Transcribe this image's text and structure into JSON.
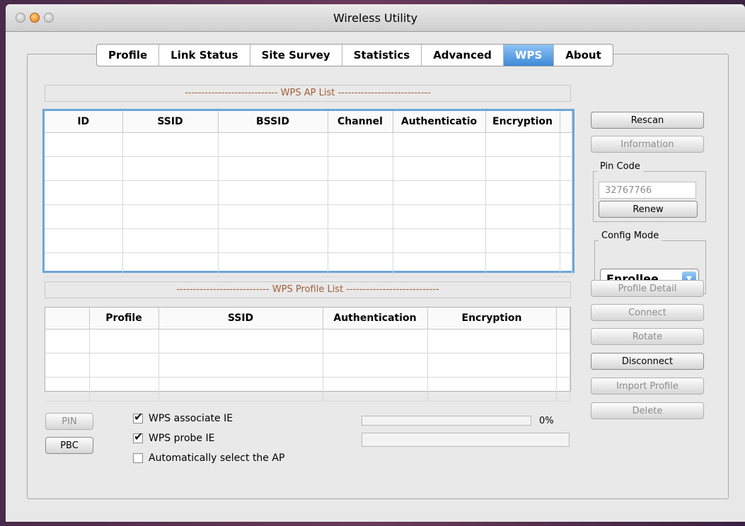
{
  "window": {
    "title": "Wireless Utility"
  },
  "tabs": [
    {
      "label": "Profile"
    },
    {
      "label": "Link Status"
    },
    {
      "label": "Site Survey"
    },
    {
      "label": "Statistics"
    },
    {
      "label": "Advanced"
    },
    {
      "label": "WPS",
      "active": true
    },
    {
      "label": "About"
    }
  ],
  "ap_list": {
    "header": "---------------------------- WPS AP List ----------------------------",
    "columns": [
      "ID",
      "SSID",
      "BSSID",
      "Channel",
      "Authenticatio",
      "Encryption"
    ],
    "rows": []
  },
  "profile_list": {
    "header": "---------------------------- WPS Profile List ----------------------------",
    "columns": [
      "",
      "Profile",
      "SSID",
      "Authentication",
      "Encryption"
    ],
    "rows": []
  },
  "buttons": {
    "rescan": "Rescan",
    "information": "Information",
    "renew": "Renew",
    "profile_detail": "Profile Detail",
    "connect": "Connect",
    "rotate": "Rotate",
    "disconnect": "Disconnect",
    "import_profile": "Import Profile",
    "delete": "Delete",
    "pin": "PIN",
    "pbc": "PBC"
  },
  "pin_code": {
    "label": "Pin Code",
    "value": "32767766"
  },
  "config_mode": {
    "label": "Config Mode",
    "value": "Enrollee"
  },
  "options": [
    {
      "label": "WPS associate IE",
      "checked": true
    },
    {
      "label": "WPS probe IE",
      "checked": true
    },
    {
      "label": "Automatically select the AP",
      "checked": false
    }
  ],
  "progress": {
    "percent_label": "0%",
    "value": 0
  },
  "colors": {
    "accent": "#3d8ad8",
    "header_text": "#a0603a"
  }
}
